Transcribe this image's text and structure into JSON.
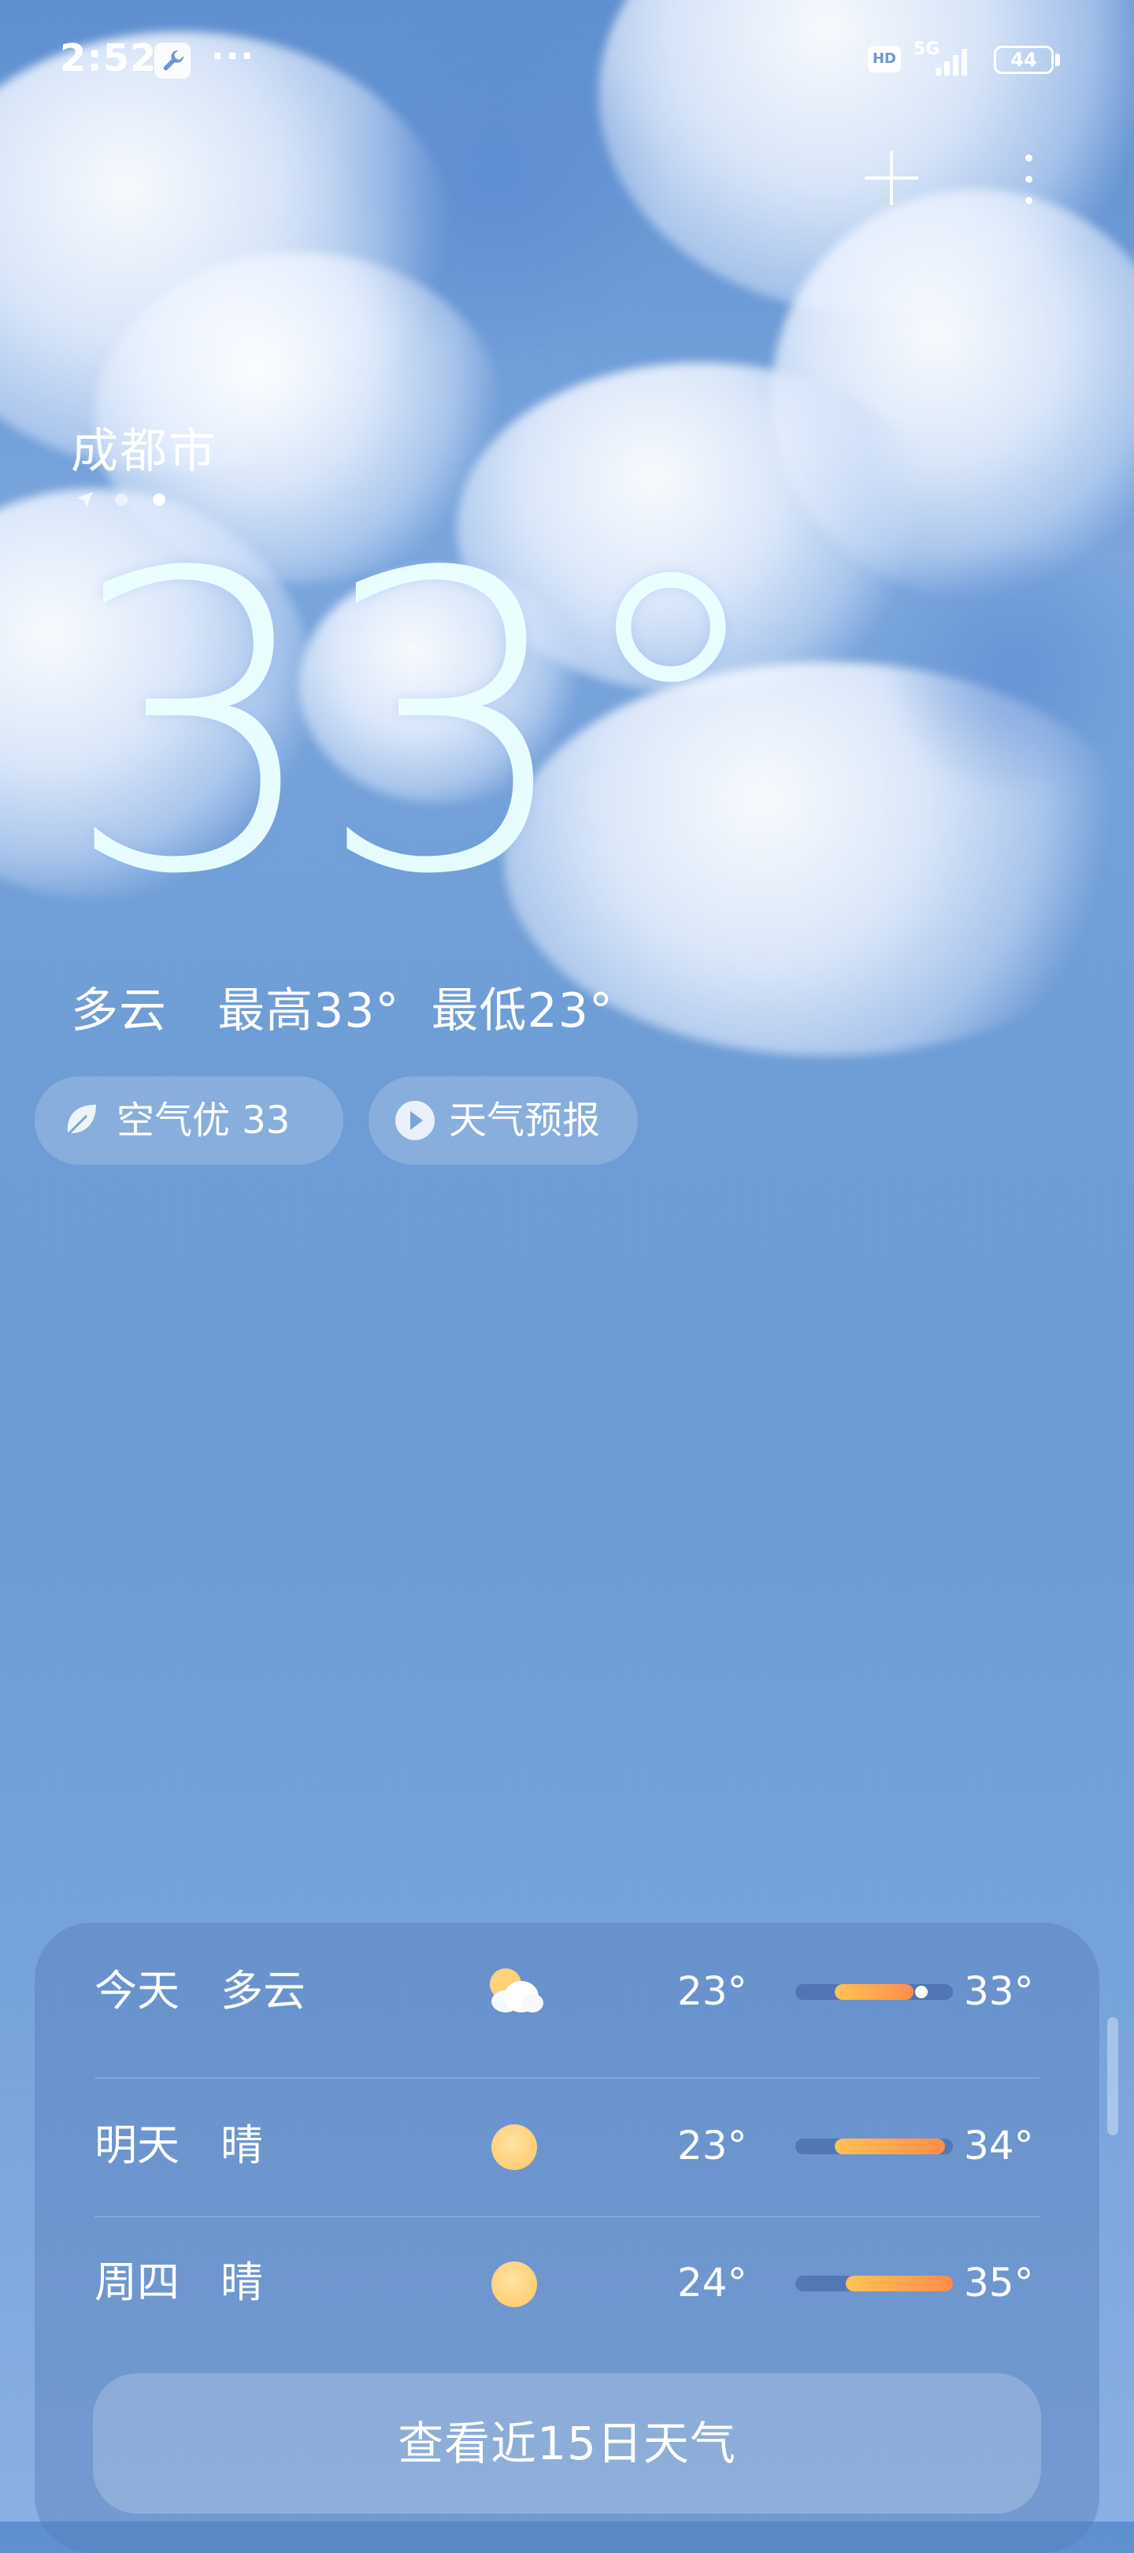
{
  "status_bar": {
    "time": "2:52",
    "more": "···",
    "hd": "HD",
    "network": "5G",
    "battery": "44"
  },
  "weather": {
    "city": "成都市",
    "temperature": "33°",
    "summary": {
      "condition": "多云",
      "high": "最高33°",
      "low": "最低23°"
    },
    "chips": {
      "air_quality": "空气优 33",
      "forecast_video": "天气预报"
    }
  },
  "forecast": {
    "days": [
      {
        "day": "今天",
        "condition": "多云",
        "icon": "partly-cloudy-icon",
        "low": "23°",
        "high": "33°",
        "range_start": 0.25,
        "range_end": 0.75,
        "current": 0.8
      },
      {
        "day": "明天",
        "condition": "晴",
        "icon": "sun-icon",
        "low": "23°",
        "high": "34°",
        "range_start": 0.25,
        "range_end": 0.95
      },
      {
        "day": "周四",
        "condition": "晴",
        "icon": "sun-icon",
        "low": "24°",
        "high": "35°",
        "range_start": 0.32,
        "range_end": 1.0
      }
    ],
    "more_label": "查看近15日天气"
  },
  "colors": {
    "bar_start": "#ffc255",
    "bar_end": "#ff8d4a",
    "sun": "#ffd27a"
  }
}
